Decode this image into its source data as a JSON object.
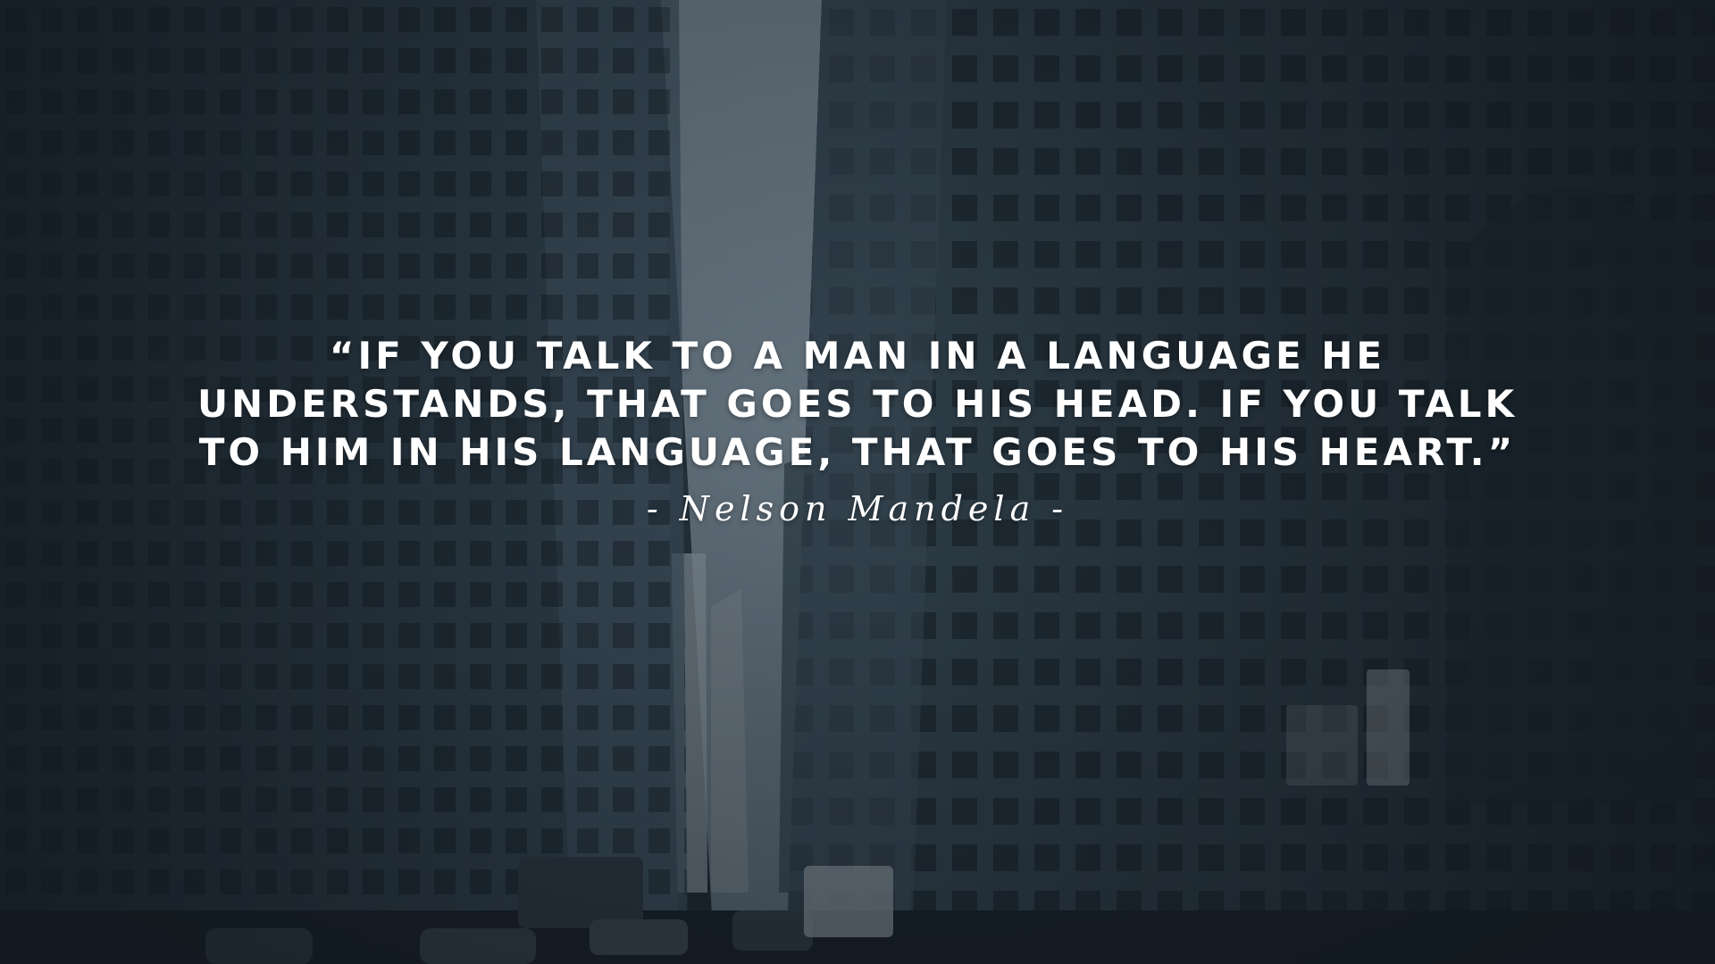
{
  "quote": {
    "text": "“If you talk to a man in a language he understands, that goes to his head. If you talk to him in his language, that goes to his heart.”",
    "author": "- Nelson Mandela -"
  },
  "background": {
    "description_icon": "city-street-skyscrapers-photo",
    "tint_color": "#26323c",
    "text_color": "#ffffff"
  }
}
